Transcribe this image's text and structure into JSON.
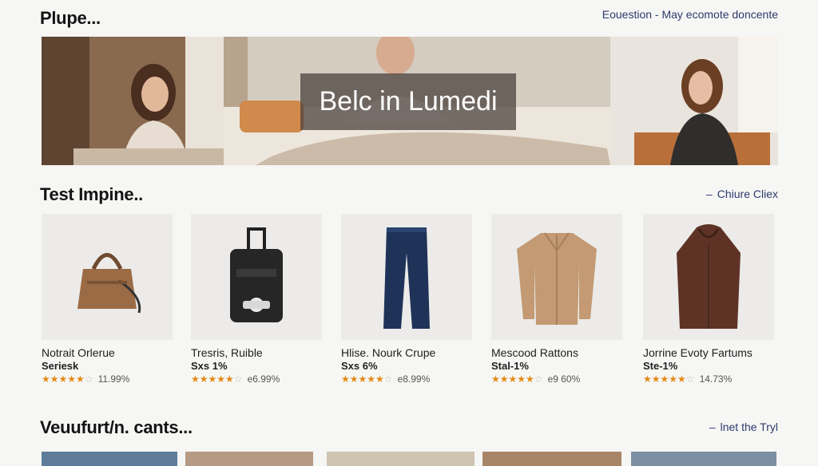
{
  "header": {
    "title": "Plupe...",
    "link": "Eouestion - May ecomote doncente"
  },
  "hero": {
    "caption": "Belc in Lumedi"
  },
  "section1": {
    "title": "Test Impine..",
    "link": "Chiure Cliex"
  },
  "products": [
    {
      "name": "Notrait Orlerue",
      "sub": "Seriesk",
      "rating": 4,
      "pct": "11.99%",
      "icon": "bag-icon"
    },
    {
      "name": "Tresris, Ruible",
      "sub": "Sxs 1%",
      "rating": 4,
      "pct": "e6.99%",
      "icon": "luggage-icon"
    },
    {
      "name": "Hlise. Nourk Crupe",
      "sub": "Sxs 6%",
      "rating": 4,
      "pct": "e8.99%",
      "icon": "pants-icon"
    },
    {
      "name": "Mescood Rattons",
      "sub": "Stal-1%",
      "rating": 4,
      "pct": "e9 60%",
      "icon": "jacket-icon"
    },
    {
      "name": "Jorrine Evoty Fartums",
      "sub": "Ste-1%",
      "rating": 4,
      "pct": "14.73%",
      "icon": "coat-icon"
    }
  ],
  "section2": {
    "title": "Veuufurt/n. cants...",
    "link": "lnet the Tryl"
  },
  "colors": {
    "accent_link": "#2e3a6e",
    "star": "#e48a12"
  }
}
